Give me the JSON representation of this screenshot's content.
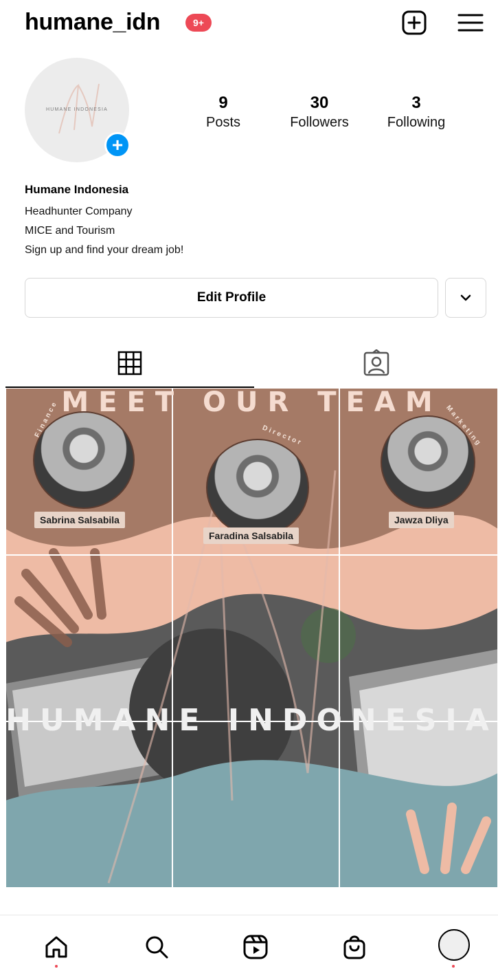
{
  "header": {
    "username": "humane_idn",
    "notification_badge": "9+",
    "icons": [
      "new-post-icon",
      "menu-icon"
    ]
  },
  "profile": {
    "avatar_text": "HUMANE INDONESIA",
    "stats": [
      {
        "value": "9",
        "label": "Posts"
      },
      {
        "value": "30",
        "label": "Followers"
      },
      {
        "value": "3",
        "label": "Following"
      }
    ],
    "name": "Humane Indonesia",
    "bio": [
      "Headhunter Company",
      "MICE and Tourism",
      "Sign up and find your dream job!"
    ],
    "edit_button": "Edit Profile"
  },
  "tabs": [
    "grid-tab",
    "tagged-tab"
  ],
  "posts": {
    "team_title": "MEET OUR TEAM",
    "members": [
      {
        "name": "Sabrina Salsabila",
        "role": "Finance"
      },
      {
        "name": "Faradina Salsabila",
        "role": "Director"
      },
      {
        "name": "Jawza Dliya",
        "role": "Marketing"
      }
    ],
    "brand_title": "HUMANE INDONESIA"
  },
  "colors": {
    "accent_blue": "#0095f6",
    "badge_red": "#ed4956",
    "post_brown": "#a57a66",
    "post_peach": "#eebba5",
    "post_teal": "#7fa6ad"
  },
  "bottom_nav": [
    "home-icon",
    "search-icon",
    "reels-icon",
    "shop-icon",
    "profile-icon"
  ]
}
